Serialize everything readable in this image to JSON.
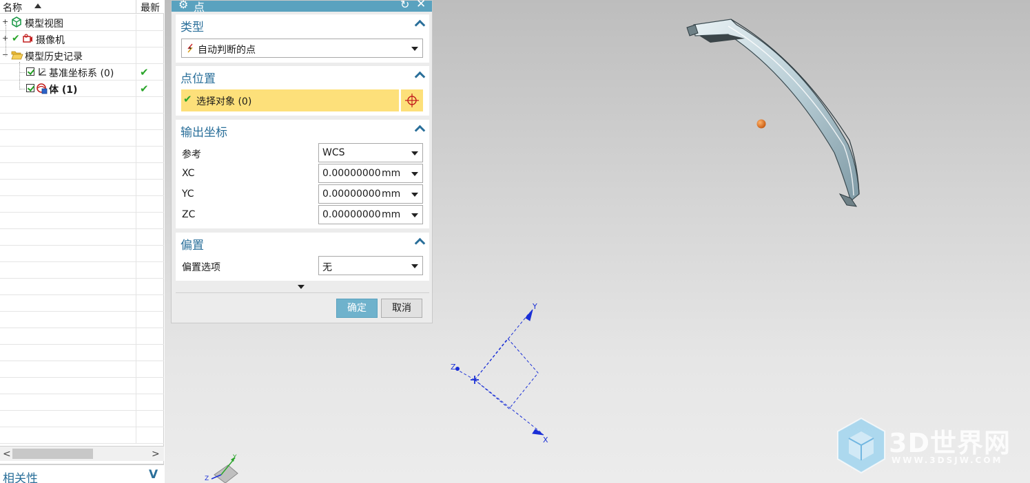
{
  "navigator": {
    "header": {
      "name_col": "名称",
      "latest_col": "最新"
    },
    "items": [
      {
        "label": "模型视图",
        "latest": ""
      },
      {
        "label": "摄像机",
        "latest": ""
      },
      {
        "label": "模型历史记录",
        "latest": ""
      },
      {
        "label": "基准坐标系 (0)",
        "latest": "✔"
      },
      {
        "label": "体 (1)",
        "latest": "✔"
      }
    ],
    "scroll": {
      "left": "<",
      "right": ">"
    }
  },
  "related_panel": {
    "title": "相关性",
    "toggle": "V"
  },
  "dialog": {
    "title": "点",
    "type_group": {
      "title": "类型",
      "value": "自动判断的点"
    },
    "point_location": {
      "title": "点位置",
      "select_label": "选择对象 (0)"
    },
    "output_coords": {
      "title": "输出坐标",
      "reference_label": "参考",
      "reference_value": "WCS",
      "xc_label": "XC",
      "xc_value": "0.00000000",
      "yc_label": "YC",
      "yc_value": "0.00000000",
      "zc_label": "ZC",
      "zc_value": "0.00000000",
      "unit": "mm"
    },
    "offset": {
      "title": "偏置",
      "option_label": "偏置选项",
      "option_value": "无"
    },
    "ok_label": "确定",
    "cancel_label": "取消"
  },
  "viewport": {
    "axis_labels": {
      "x": "X",
      "y": "Y",
      "z": "Z"
    },
    "triad_labels": {
      "y": "Y",
      "z": "Z"
    }
  },
  "watermark": {
    "text": "3D世界网",
    "url": "WWW.3DSJW.COM"
  },
  "colors": {
    "accent": "#2a6f9a",
    "titlebar": "#5aa2bf",
    "selection": "#fde07a",
    "wcs_axis": "#1a2fd6",
    "point_marker": "#e5761c"
  }
}
